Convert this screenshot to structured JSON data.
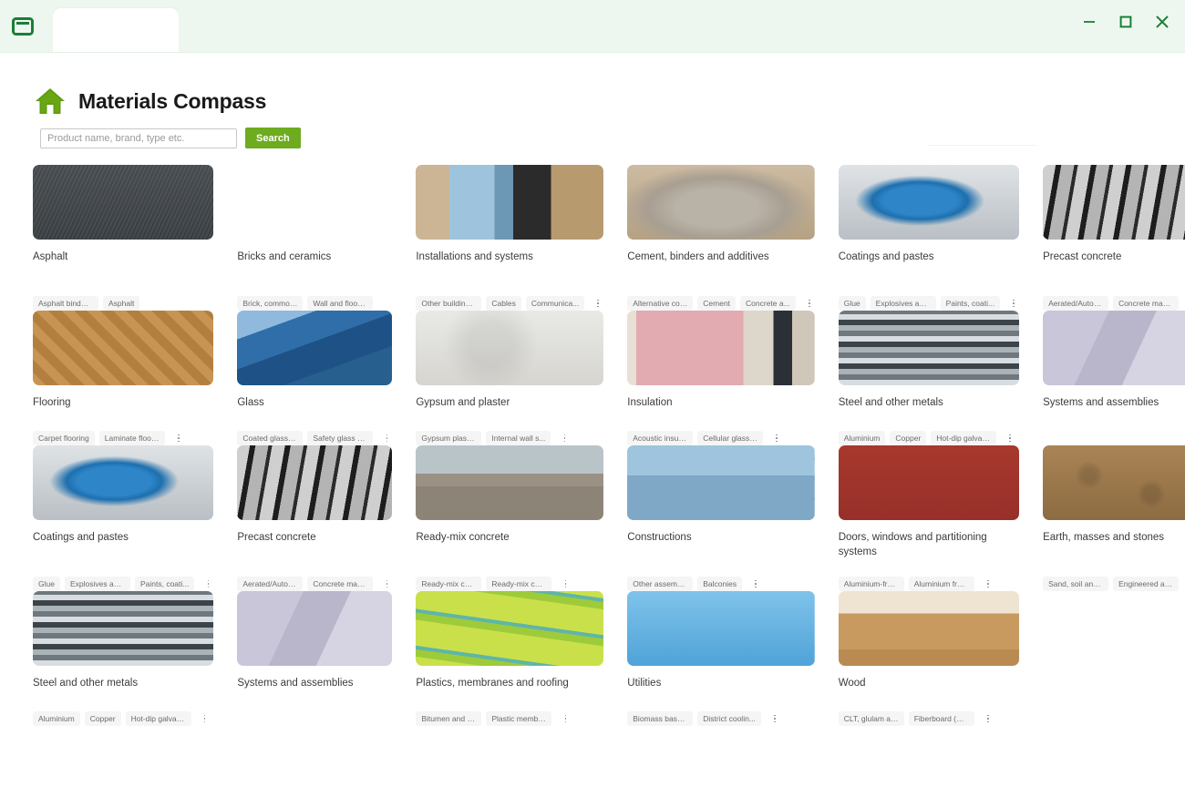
{
  "window": {
    "app_icon": "browser-window-icon",
    "tab_label": "",
    "controls": {
      "minimize": "minimize-icon",
      "maximize": "maximize-icon",
      "close": "close-icon"
    },
    "accent_green": "#1a7f37",
    "titlebar_bg": "#eef7ef"
  },
  "header": {
    "home_icon": "home-icon",
    "title": "Materials Compass",
    "brand_green": "#6aa515"
  },
  "search": {
    "placeholder": "Product name, brand, type etc.",
    "value": "",
    "button_label": "Search",
    "button_color": "#6eab1f"
  },
  "grid": {
    "rows": [
      {
        "cards": [
          {
            "title": "Asphalt",
            "image": "asphalt-road-marking",
            "tags": [
              "Asphalt binders...",
              "Asphalt"
            ],
            "has_menu": false
          },
          {
            "title": "Bricks and ceramics",
            "image": "red-bricks-wall",
            "tags": [
              "Brick, common c...",
              "Wall and floor ..."
            ],
            "has_menu": false
          },
          {
            "title": "Installations and systems",
            "image": "blue-pipes-installation",
            "tags": [
              "Other building ...",
              "Cables",
              "Communica..."
            ],
            "has_menu": true
          },
          {
            "title": "Cement, binders and additives",
            "image": "cement-bag-trowel",
            "tags": [
              "Alternative con...",
              "Cement",
              "Concrete a..."
            ],
            "has_menu": true
          },
          {
            "title": "Coatings and pastes",
            "image": "paint-bucket-blue",
            "tags": [
              "Glue",
              "Explosives and ...",
              "Paints, coati..."
            ],
            "has_menu": true
          },
          {
            "title": "Precast concrete",
            "image": "precast-concrete-panels",
            "tags": [
              "Aerated/Autocla...",
              "Concrete masonr..."
            ],
            "has_menu": true
          }
        ]
      },
      {
        "cards": [
          {
            "title": "Flooring",
            "image": "wood-parquet-floor",
            "tags": [
              "Carpet flooring",
              "Laminate floori..."
            ],
            "has_menu": true
          },
          {
            "title": "Glass",
            "image": "glass-facade-skyscraper",
            "tags": [
              "Coated glass pa...",
              "Safety glass pa..."
            ],
            "has_menu": true
          },
          {
            "title": "Gypsum and plaster",
            "image": "white-plaster-texture",
            "tags": [
              "Gypsum plaster ...",
              "Internal wall s..."
            ],
            "has_menu": true
          },
          {
            "title": "Insulation",
            "image": "pink-mineral-wool-insulation",
            "tags": [
              "Acoustic insula...",
              "Cellular glass ..."
            ],
            "has_menu": true
          },
          {
            "title": "Steel and other metals",
            "image": "steel-pipes-stack",
            "tags": [
              "Aluminium",
              "Copper",
              "Hot-dip galvani..."
            ],
            "has_menu": true
          },
          {
            "title": "Systems and assemblies",
            "image": "cable-tray-systems",
            "tags": [],
            "has_menu": false
          }
        ]
      },
      {
        "cards": [
          {
            "title": "Coatings and pastes",
            "image": "paint-bucket-blue",
            "tags": [
              "Glue",
              "Explosives and ...",
              "Paints, coati..."
            ],
            "has_menu": true
          },
          {
            "title": "Precast concrete",
            "image": "precast-concrete-panels",
            "tags": [
              "Aerated/Autocla...",
              "Concrete masonr..."
            ],
            "has_menu": true
          },
          {
            "title": "Ready-mix concrete",
            "image": "concrete-mixer-truck",
            "tags": [
              "Ready-mix concr...",
              "Ready-mix concr..."
            ],
            "has_menu": true
          },
          {
            "title": "Constructions",
            "image": "construction-scaffolding",
            "tags": [
              "Other assemblie...",
              "Balconies"
            ],
            "has_menu": true
          },
          {
            "title": "Doors, windows and partitioning systems",
            "image": "red-brick-building-windows",
            "tags": [
              "Aluminium-frame...",
              "Aluminium frame..."
            ],
            "has_menu": true
          },
          {
            "title": "Earth, masses and stones",
            "image": "brown-soil-earth",
            "tags": [
              "Sand, soil and ...",
              "Engineered aggr..."
            ],
            "has_menu": true
          }
        ]
      },
      {
        "cards": [
          {
            "title": "Steel and other metals",
            "image": "steel-pipes-stack",
            "tags": [
              "Aluminium",
              "Copper",
              "Hot-dip galvani..."
            ],
            "has_menu": true
          },
          {
            "title": "Systems and assemblies",
            "image": "cable-tray-systems",
            "tags": [],
            "has_menu": false
          },
          {
            "title": "Plastics, membranes and roofing",
            "image": "green-plastic-membrane",
            "tags": [
              "Bitumen and oth...",
              "Plastic membran..."
            ],
            "has_menu": true
          },
          {
            "title": "Utilities",
            "image": "electricity-pylon-sky",
            "tags": [
              "Biomass based, ...",
              "District coolin..."
            ],
            "has_menu": true
          },
          {
            "title": "Wood",
            "image": "timber-beams-stack",
            "tags": [
              "CLT, glulam and...",
              "Fiberboard (MDF..."
            ],
            "has_menu": true
          },
          {
            "title": "",
            "image": "",
            "tags": [],
            "has_menu": false
          }
        ]
      }
    ]
  }
}
